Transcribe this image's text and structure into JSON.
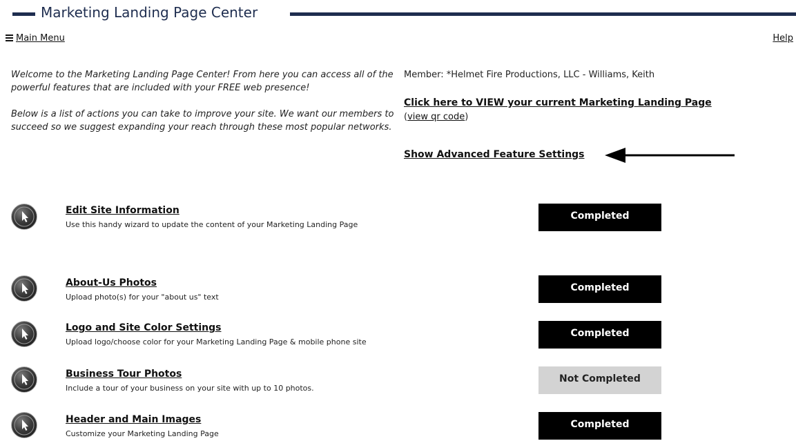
{
  "header": {
    "title": "Marketing Landing Page Center"
  },
  "nav": {
    "main_menu": "Main Menu",
    "help": "Help"
  },
  "intro": {
    "p1": "Welcome to the Marketing Landing Page Center! From here you can access all of the powerful features that are included with your FREE web presence!",
    "p2": "Below is a list of actions you can take to improve your site. We want our members to succeed so we suggest expanding your reach through these most popular networks."
  },
  "member": {
    "label": "Member: *Helmet Fire Productions, LLC - Williams, Keith",
    "view_link": "Click here to VIEW your current Marketing Landing Page",
    "qr_link": "view qr code",
    "advanced_link": "Show Advanced Feature Settings"
  },
  "colors": {
    "title_bar": "#1e2d4f",
    "completed_bg": "#000000",
    "not_completed_bg": "#d3d3d3"
  },
  "tasks": [
    {
      "title": "Edit Site Information",
      "desc": "Use this handy wizard to update the content of your Marketing Landing Page",
      "status": "Completed"
    },
    {
      "title": "About-Us Photos",
      "desc": "Upload photo(s) for your \"about us\" text",
      "status": "Completed"
    },
    {
      "title": "Logo and Site Color Settings",
      "desc": "Upload logo/choose color for your Marketing Landing Page & mobile phone site",
      "status": "Completed"
    },
    {
      "title": "Business Tour Photos",
      "desc": "Include a tour of your business on your site with up to 10 photos.",
      "status": "Not Completed"
    },
    {
      "title": "Header and Main Images",
      "desc": "Customize your Marketing Landing Page",
      "status": "Completed"
    }
  ]
}
